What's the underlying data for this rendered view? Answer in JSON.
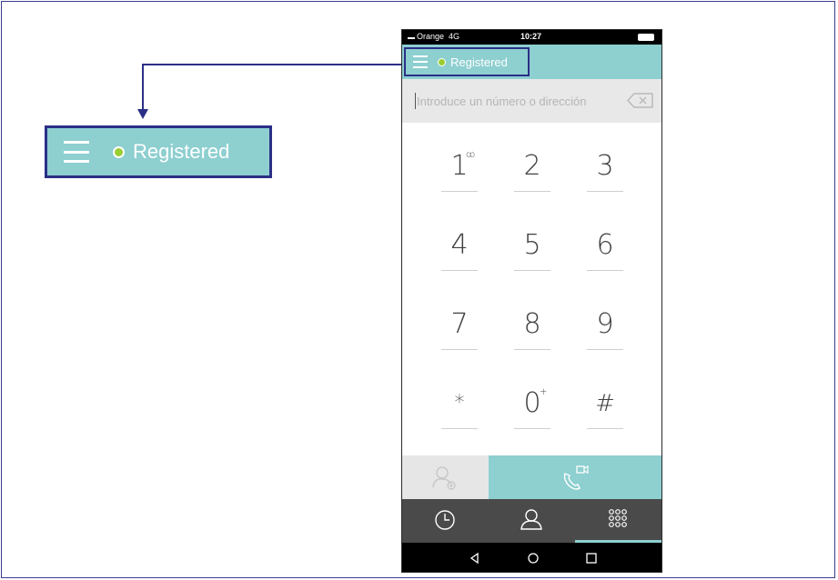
{
  "callout": {
    "status_label": "Registered"
  },
  "phone": {
    "status_bar": {
      "carrier": "Orange",
      "network": "4G",
      "time": "10:27"
    },
    "header": {
      "status_label": "Registered"
    },
    "dialer": {
      "placeholder": "Introduce un número o dirección"
    },
    "keys": [
      {
        "digit": "1",
        "sup": "ꝏ"
      },
      {
        "digit": "2",
        "sup": ""
      },
      {
        "digit": "3",
        "sup": ""
      },
      {
        "digit": "4",
        "sup": ""
      },
      {
        "digit": "5",
        "sup": ""
      },
      {
        "digit": "6",
        "sup": ""
      },
      {
        "digit": "7",
        "sup": ""
      },
      {
        "digit": "8",
        "sup": ""
      },
      {
        "digit": "9",
        "sup": ""
      },
      {
        "digit": "*",
        "sup": ""
      },
      {
        "digit": "0",
        "sup": "+"
      },
      {
        "digit": "#",
        "sup": ""
      }
    ],
    "action_bar": {
      "left_icon": "add-contact-icon",
      "right_icon": "video-call-icon"
    },
    "tabs": [
      {
        "icon": "history-clock-icon",
        "selected": false
      },
      {
        "icon": "contacts-person-icon",
        "selected": false
      },
      {
        "icon": "dialpad-grid-icon",
        "selected": true
      }
    ],
    "nav": [
      "back-triangle-icon",
      "home-circle-icon",
      "recents-square-icon"
    ]
  },
  "colors": {
    "accent": "#8ecfd0",
    "highlight_border": "#2b2f86",
    "registered_dot": "#9acd32"
  }
}
